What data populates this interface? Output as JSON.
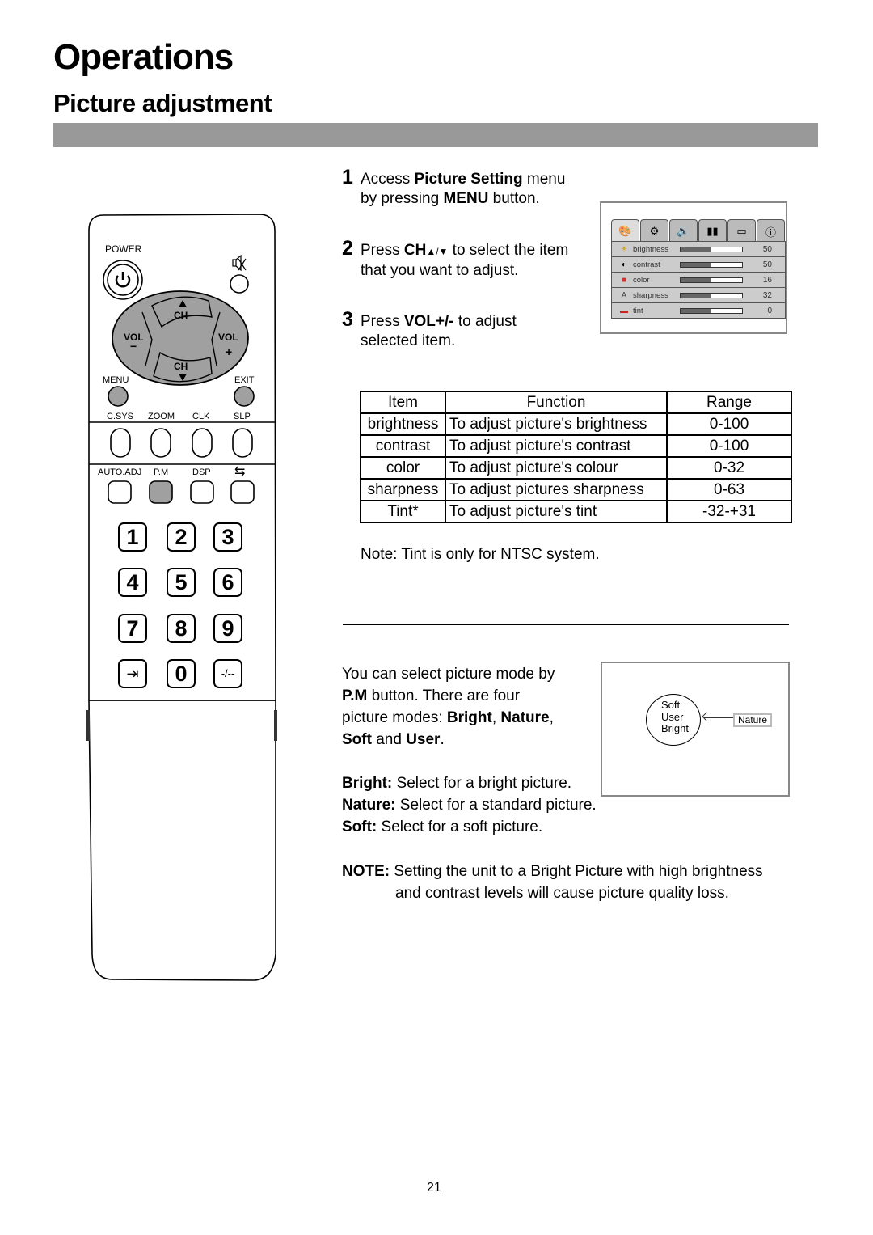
{
  "page": {
    "title": "Operations",
    "subtitle": "Picture adjustment",
    "page_number": "21"
  },
  "steps": [
    {
      "num": "1",
      "parts": [
        "Access ",
        "Picture Setting",
        " menu",
        "by pressing ",
        "MENU",
        " button."
      ]
    },
    {
      "num": "2",
      "parts": [
        "Press ",
        "CH",
        "▲/▼",
        " to select the item",
        "that you want to adjust."
      ]
    },
    {
      "num": "3",
      "parts": [
        "Press ",
        "VOL+/-",
        " to adjust",
        "selected item."
      ]
    }
  ],
  "osd_menu": {
    "tabs": [
      {
        "icon": "picture-icon",
        "glyph": "🎨",
        "active": true
      },
      {
        "icon": "setup-icon",
        "glyph": "⚙",
        "active": false
      },
      {
        "icon": "sound-icon",
        "glyph": "🔊",
        "active": false
      },
      {
        "icon": "channel-icon",
        "glyph": "▮▮",
        "active": false
      },
      {
        "icon": "display-icon",
        "glyph": "▭",
        "active": false
      },
      {
        "icon": "info-icon",
        "glyph": "ⓘ",
        "active": false
      }
    ],
    "items": [
      {
        "icon": "brightness-icon",
        "glyph": "☀",
        "label": "brightness",
        "value": "50",
        "fill": 0.5
      },
      {
        "icon": "contrast-icon",
        "glyph": "◐",
        "label": "contrast",
        "value": "50",
        "fill": 0.5
      },
      {
        "icon": "color-icon",
        "glyph": "■",
        "label": "color",
        "value": "16",
        "fill": 0.5
      },
      {
        "icon": "sharpness-icon",
        "glyph": "A",
        "label": "sharpness",
        "value": "32",
        "fill": 0.5
      },
      {
        "icon": "tint-icon",
        "glyph": "▬",
        "label": "tint",
        "value": "0",
        "fill": 0.5
      }
    ]
  },
  "table": {
    "headers": [
      "Item",
      "Function",
      "Range"
    ],
    "rows": [
      [
        "brightness",
        "To adjust picture's brightness",
        "0-100"
      ],
      [
        "contrast",
        "To adjust picture's contrast",
        "0-100"
      ],
      [
        "color",
        "To adjust picture's colour",
        "0-32"
      ],
      [
        "sharpness",
        "To adjust pictures sharpness",
        "0-63"
      ],
      [
        "Tint*",
        "To adjust picture's tint",
        "-32-+31"
      ]
    ],
    "note": "Note: Tint is only for NTSC system."
  },
  "picture_mode": {
    "intro": {
      "l1": "You can select picture mode by",
      "l2_bold": "P.M",
      "l2": " button. There are four",
      "l3": "picture modes: ",
      "l3_b1": "Bright",
      "l3_sep": ", ",
      "l3_b2": "Nature",
      "l3_end": ",",
      "l4_b1": "Soft",
      "l4_mid": " and ",
      "l4_b2": "User",
      "l4_end": "."
    },
    "descriptions": [
      {
        "term": "Bright:",
        "text": " Select for a bright picture."
      },
      {
        "term": "Nature:",
        "text": " Select for a standard picture."
      },
      {
        "term": "Soft:",
        "text": " Select for a soft picture."
      }
    ],
    "diagram": {
      "circle_modes": [
        "Soft",
        "User",
        "Bright"
      ],
      "current_mode": "Nature"
    },
    "note": {
      "label": "NOTE:",
      "l1": " Setting the unit to a Bright Picture with high brightness",
      "l2": "and contrast levels will cause picture quality loss."
    }
  },
  "remote": {
    "power_label": "POWER",
    "ch_label": "CH",
    "vol_label": "VOL",
    "vol_minus": "−",
    "vol_plus": "+",
    "menu_label": "MENU",
    "exit_label": "EXIT",
    "row1_labels": [
      "C.SYS",
      "ZOOM",
      "CLK",
      "SLP"
    ],
    "row2_labels": [
      "AUTO.ADJ",
      "P.M",
      "DSP",
      "⇆"
    ],
    "numkeys": [
      "1",
      "2",
      "3",
      "4",
      "5",
      "6",
      "7",
      "8",
      "9",
      "⇥",
      "0",
      "-/--"
    ],
    "highlight_color": "#a0a0a0"
  }
}
